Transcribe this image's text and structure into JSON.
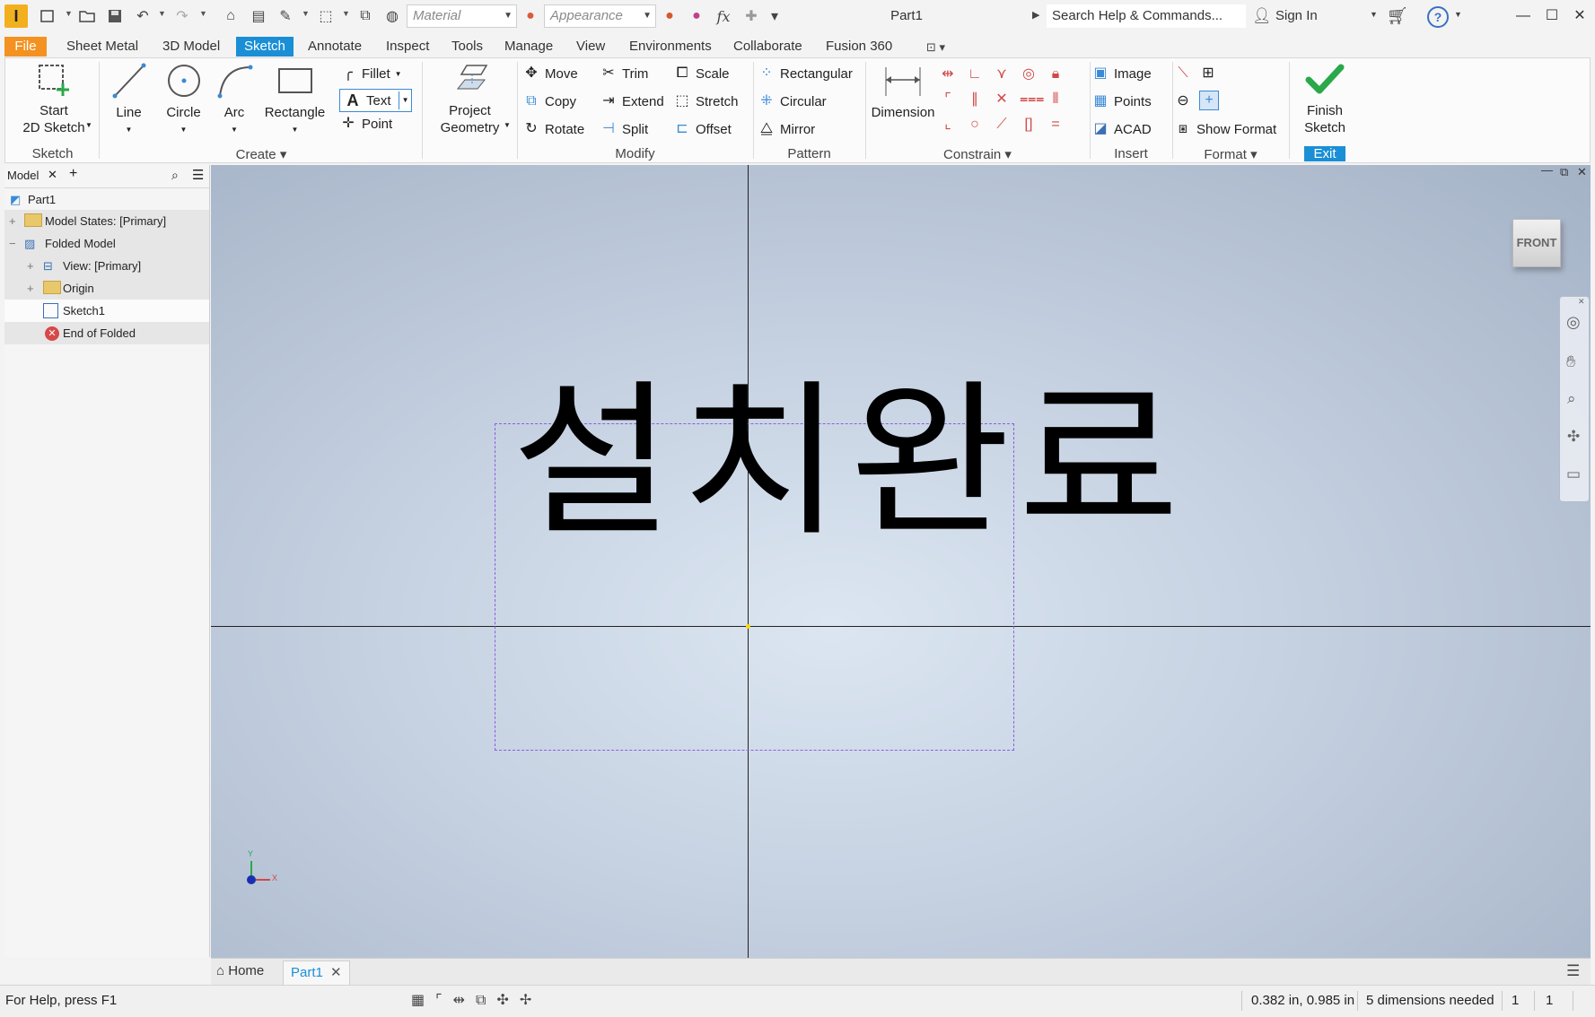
{
  "titlebar": {
    "app_icon_letter": "I",
    "material_placeholder": "Material",
    "appearance_placeholder": "Appearance",
    "fx_label": "fx",
    "document_title": "Part1",
    "search_placeholder": "Search Help & Commands...",
    "sign_in": "Sign In"
  },
  "menu_tabs": [
    "File",
    "Sheet Metal",
    "3D Model",
    "Sketch",
    "Annotate",
    "Inspect",
    "Tools",
    "Manage",
    "View",
    "Environments",
    "Collaborate",
    "Fusion 360"
  ],
  "active_tab": "Sketch",
  "ribbon": {
    "sketch": {
      "start_line1": "Start",
      "start_line2": "2D Sketch",
      "group": "Sketch"
    },
    "create": {
      "line": "Line",
      "circle": "Circle",
      "arc": "Arc",
      "rectangle": "Rectangle",
      "fillet": "Fillet",
      "text": "Text",
      "point": "Point",
      "group": "Create"
    },
    "project": {
      "line1": "Project",
      "line2": "Geometry"
    },
    "modify": {
      "move": "Move",
      "copy": "Copy",
      "rotate": "Rotate",
      "trim": "Trim",
      "extend": "Extend",
      "split": "Split",
      "scale": "Scale",
      "stretch": "Stretch",
      "offset": "Offset",
      "group": "Modify"
    },
    "pattern": {
      "rectangular": "Rectangular",
      "circular": "Circular",
      "mirror": "Mirror",
      "group": "Pattern"
    },
    "constrain": {
      "dimension": "Dimension",
      "group": "Constrain"
    },
    "insert": {
      "image": "Image",
      "points": "Points",
      "acad": "ACAD",
      "group": "Insert"
    },
    "format": {
      "show_format": "Show Format",
      "group": "Format"
    },
    "exit": {
      "finish_line1": "Finish",
      "finish_line2": "Sketch",
      "group": "Exit"
    }
  },
  "browser": {
    "tab": "Model",
    "items": [
      {
        "label": "Part1"
      },
      {
        "label": "Model States: [Primary]"
      },
      {
        "label": "Folded Model"
      },
      {
        "label": "View: [Primary]"
      },
      {
        "label": "Origin"
      },
      {
        "label": "Sketch1"
      },
      {
        "label": "End of Folded"
      }
    ]
  },
  "canvas": {
    "sketch_text": "설치완료",
    "viewcube_label": "FRONT",
    "axis_y": "Y",
    "axis_x": "X"
  },
  "doc_tabs": {
    "home": "Home",
    "part": "Part1"
  },
  "status": {
    "help": "For Help, press F1",
    "coords": "0.382 in, 0.985 in",
    "dims": "5 dimensions needed",
    "count1": "1",
    "count2": "1"
  },
  "colors": {
    "accent_blue": "#1a8fd6",
    "file_orange": "#f39221",
    "finish_green": "#2aa84a"
  }
}
